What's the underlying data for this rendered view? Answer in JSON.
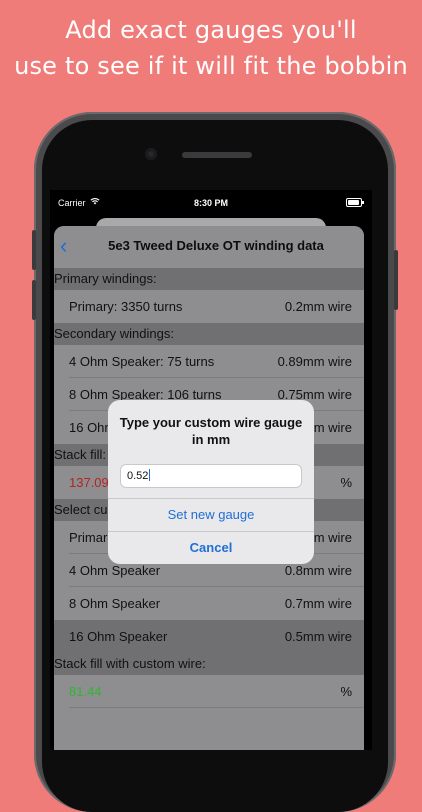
{
  "headline": {
    "line1": "Add exact gauges you'll",
    "line2": "use to see if it will fit the bobbin"
  },
  "status": {
    "carrier": "Carrier",
    "time": "8:30 PM"
  },
  "nav": {
    "title": "5e3 Tweed Deluxe OT winding data"
  },
  "sections": {
    "primary": "Primary windings:",
    "secondary": "Secondary windings:",
    "stack_fill": "Stack fill:",
    "select_custom": "Select cu",
    "stack_custom": "Stack fill with custom wire:"
  },
  "rows": {
    "primary": {
      "label": "Primary: 3350 turns",
      "value": "0.2mm wire"
    },
    "sec4": {
      "label": "4 Ohm Speaker: 75 turns",
      "value": "0.89mm wire"
    },
    "sec8": {
      "label": "8 Ohm Speaker: 106 turns",
      "value": "0.75mm wire"
    },
    "sec16": {
      "label": "16 Ohm",
      "value": "m wire"
    },
    "stack": {
      "label": "137.09",
      "value": "%"
    },
    "cust_primary": {
      "label": "Primar",
      "value": "m wire"
    },
    "cust4": {
      "label": "4 Ohm Speaker",
      "value": "0.8mm wire"
    },
    "cust8": {
      "label": "8 Ohm Speaker",
      "value": "0.7mm wire"
    },
    "cust16": {
      "label": "16 Ohm Speaker",
      "value": "0.5mm wire"
    },
    "stack_custom": {
      "label": "81.44",
      "value": "%"
    }
  },
  "alert": {
    "title_line1": "Type your custom wire gauge",
    "title_line2": "in mm",
    "input_value": "0.52",
    "set_button": "Set new gauge",
    "cancel_button": "Cancel"
  },
  "colors": {
    "background": "#f07c7a",
    "accent": "#1f6fd4",
    "over_fill": "#b52322",
    "ok_fill": "#2db82d"
  },
  "icons": [
    "back-chevron-icon",
    "wifi-icon",
    "battery-icon"
  ]
}
